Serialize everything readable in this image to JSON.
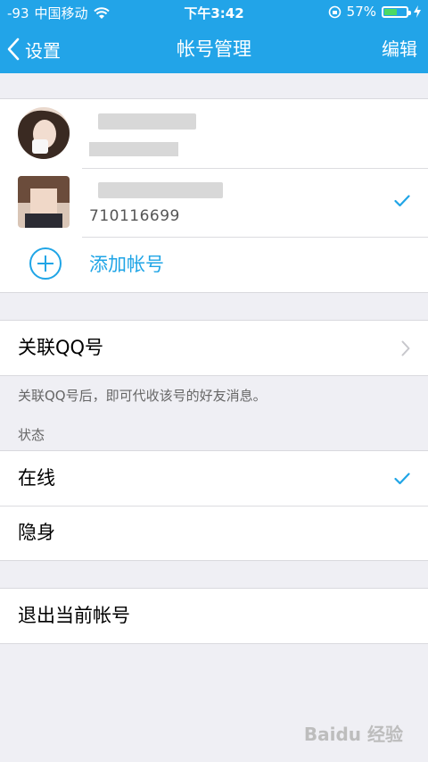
{
  "status_bar": {
    "signal": "-93",
    "carrier": "中国移动",
    "time": "下午3:42",
    "battery_percent": "57%",
    "battery_level": 0.57
  },
  "nav": {
    "back_label": "设置",
    "title": "帐号管理",
    "edit_label": "编辑"
  },
  "accounts": [
    {
      "name": "",
      "sub": "",
      "selected": false
    },
    {
      "name": "",
      "sub": "710116699",
      "selected": true
    }
  ],
  "add_account_label": "添加帐号",
  "link_qq": {
    "label": "关联QQ号",
    "hint": "关联QQ号后，即可代收该号的好友消息。"
  },
  "status_section": {
    "header": "状态",
    "options": [
      {
        "label": "在线",
        "selected": true
      },
      {
        "label": "隐身",
        "selected": false
      }
    ]
  },
  "logout_label": "退出当前帐号",
  "watermark": "Baidu 经验",
  "colors": {
    "accent": "#22a4e8",
    "link": "#20a5e6",
    "background": "#efeff4"
  }
}
